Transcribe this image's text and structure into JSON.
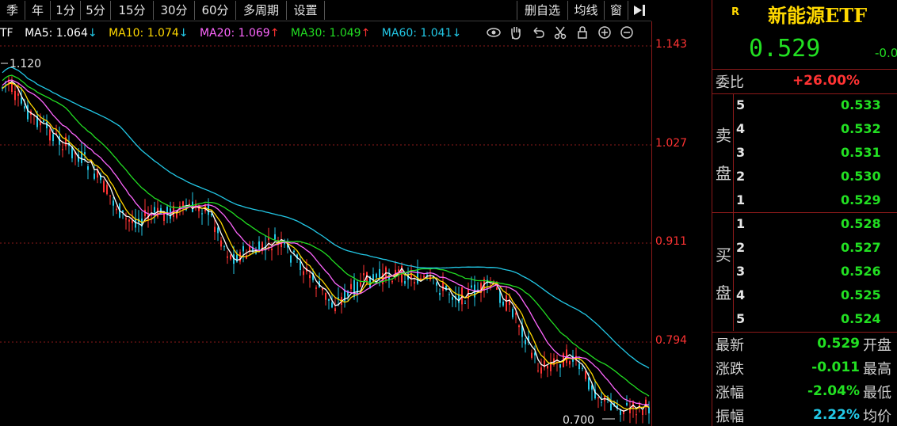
{
  "toolbar": {
    "periods": [
      "季",
      "年",
      "1分",
      "5分",
      "15分",
      "30分",
      "60分",
      "多周期",
      "设置"
    ],
    "right_tools": [
      "删自选",
      "均线",
      "窗"
    ]
  },
  "legend": {
    "prefix": "TF",
    "ma": [
      {
        "label": "MA5: 1.064",
        "arrow": "↓",
        "color": "#ffffff"
      },
      {
        "label": "MA10: 1.074",
        "arrow": "↓",
        "color": "#ffd800"
      },
      {
        "label": "MA20: 1.069",
        "arrow": "↑",
        "color": "#ff66ff"
      },
      {
        "label": "MA30: 1.049",
        "arrow": "↑",
        "color": "#22dd22"
      },
      {
        "label": "MA60: 1.041",
        "arrow": "↓",
        "color": "#22c8e6"
      }
    ]
  },
  "chart": {
    "price_axis": [
      "1.143",
      "1.027",
      "0.911",
      "0.794"
    ],
    "high_label": "1.120",
    "low_label": "0.700"
  },
  "quote": {
    "badge": "R",
    "name": "新能源ETF",
    "price": "0.529",
    "change": "-0.0",
    "commission_label": "委比",
    "commission_value": "+26.00%",
    "sell_side_label": [
      "卖",
      "盘"
    ],
    "buy_side_label": [
      "买",
      "盘"
    ],
    "sell": [
      {
        "level": "5",
        "price": "0.533"
      },
      {
        "level": "4",
        "price": "0.532"
      },
      {
        "level": "3",
        "price": "0.531"
      },
      {
        "level": "2",
        "price": "0.530"
      },
      {
        "level": "1",
        "price": "0.529"
      }
    ],
    "buy": [
      {
        "level": "1",
        "price": "0.528"
      },
      {
        "level": "2",
        "price": "0.527"
      },
      {
        "level": "3",
        "price": "0.526"
      },
      {
        "level": "4",
        "price": "0.525"
      },
      {
        "level": "5",
        "price": "0.524"
      }
    ],
    "stats": [
      {
        "label": "最新",
        "value": "0.529",
        "extra": "开盘",
        "color": "#22e022"
      },
      {
        "label": "涨跌",
        "value": "-0.011",
        "extra": "最高",
        "color": "#22e022"
      },
      {
        "label": "涨幅",
        "value": "-2.04%",
        "extra": "最低",
        "color": "#22e022"
      },
      {
        "label": "振幅",
        "value": "2.22%",
        "extra": "均价",
        "color": "#22c8e6"
      }
    ]
  },
  "colors": {
    "up": "#ff3333",
    "down": "#22c8e6",
    "grid": "#8c1a1a"
  }
}
